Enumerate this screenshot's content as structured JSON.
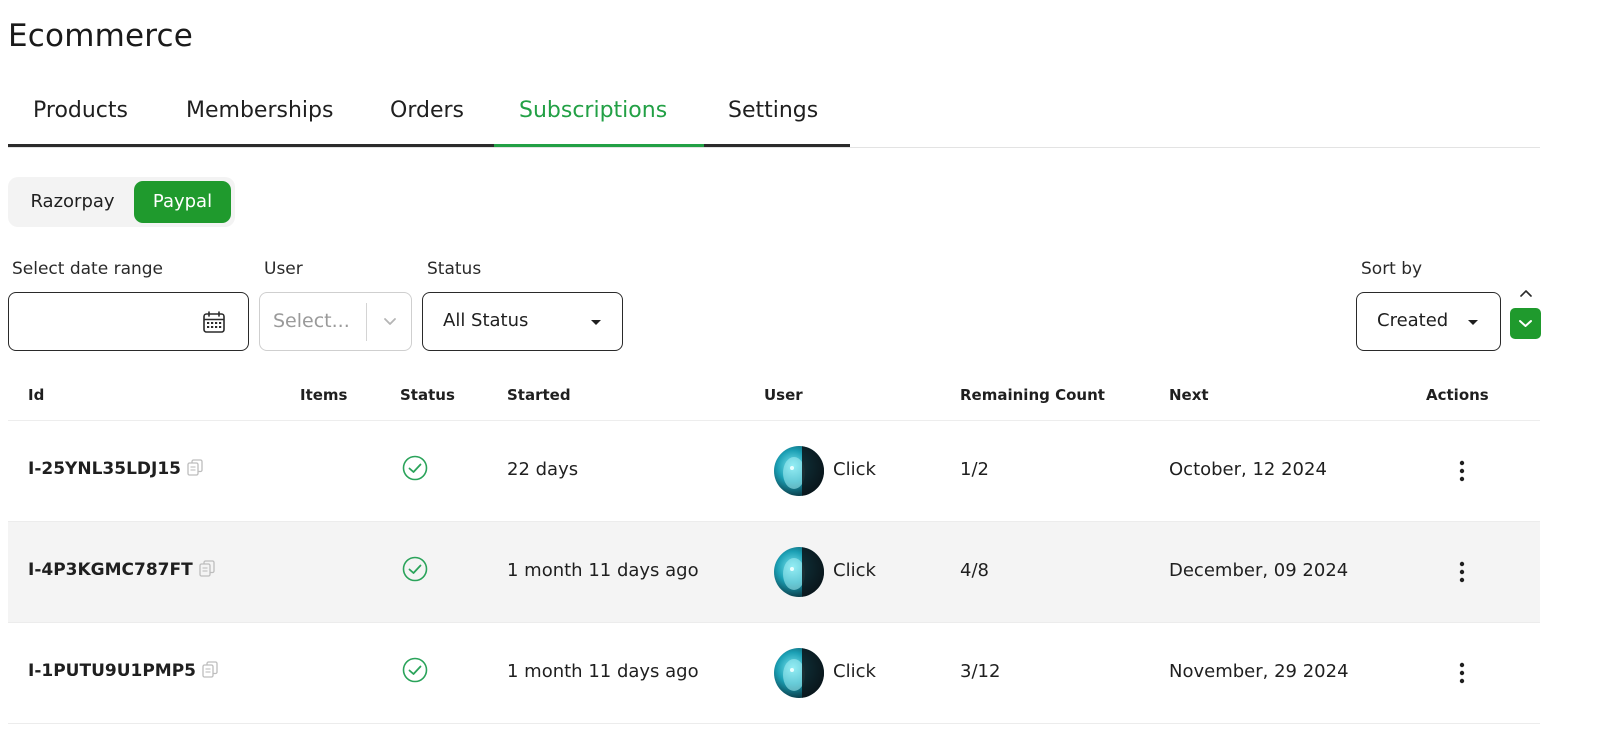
{
  "page": {
    "title": "Ecommerce"
  },
  "tabs": [
    {
      "label": "Products",
      "active": false
    },
    {
      "label": "Memberships",
      "active": false
    },
    {
      "label": "Orders",
      "active": false
    },
    {
      "label": "Subscriptions",
      "active": true
    },
    {
      "label": "Settings",
      "active": false
    }
  ],
  "gateways": {
    "options": [
      "Razorpay",
      "Paypal"
    ],
    "selected": "Paypal"
  },
  "filters": {
    "date_range": {
      "label": "Select date range",
      "value": "",
      "icon": "calendar-icon"
    },
    "user": {
      "label": "User",
      "placeholder": "Select..."
    },
    "status": {
      "label": "Status",
      "value": "All Status"
    },
    "sort": {
      "label": "Sort by",
      "value": "Created",
      "direction": "descending"
    }
  },
  "table": {
    "columns": [
      "Id",
      "Items",
      "Status",
      "Started",
      "User",
      "Remaining Count",
      "Next",
      "Actions"
    ],
    "rows": [
      {
        "id": "I-25YNL35LDJ15",
        "items": "",
        "status": "active",
        "started": "22 days",
        "user": "Click",
        "remaining": "1/2",
        "next": "October, 12 2024"
      },
      {
        "id": "I-4P3KGMC787FT",
        "items": "",
        "status": "active",
        "started": "1 month 11 days ago",
        "user": "Click",
        "remaining": "4/8",
        "next": "December, 09 2024"
      },
      {
        "id": "I-1PUTU9U1PMP5",
        "items": "",
        "status": "active",
        "started": "1 month 11 days ago",
        "user": "Click",
        "remaining": "3/12",
        "next": "November, 29 2024"
      }
    ]
  },
  "colors": {
    "accent": "#1f9a2d",
    "tab_active": "#22a045",
    "status_ok": "#2aa35a",
    "alt_row": "#f4f4f4"
  }
}
